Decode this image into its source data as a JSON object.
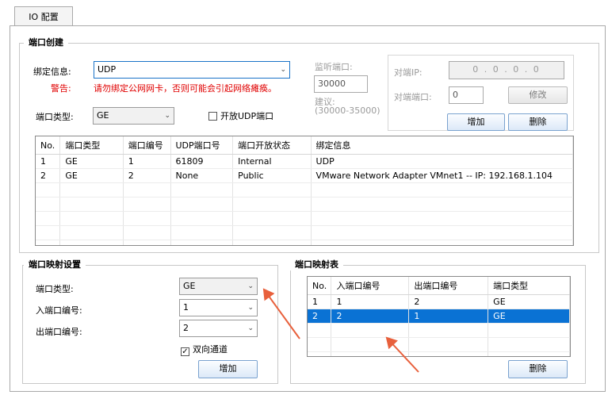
{
  "tab": {
    "label": "IO 配置"
  },
  "creation": {
    "title": "端口创建",
    "bind_label": "绑定信息:",
    "bind_value": "UDP",
    "warn_label": "警告:",
    "warn_text": "请勿绑定公网网卡，否则可能会引起网络瘫痪。",
    "type_label": "端口类型:",
    "type_value": "GE",
    "open_udp_label": "开放UDP端口",
    "listen_label": "监听端口:",
    "listen_value": "30000",
    "suggest_label": "建议:",
    "suggest_range": "(30000-35000)",
    "peer_ip_label": "对端IP:",
    "peer_ip_value": "0 . 0 . 0 . 0",
    "peer_port_label": "对端端口:",
    "peer_port_value": "0",
    "modify_label": "修改",
    "add_label": "增加",
    "delete_label": "删除",
    "table": {
      "headers": [
        "No.",
        "端口类型",
        "端口编号",
        "UDP端口号",
        "端口开放状态",
        "绑定信息"
      ],
      "rows": [
        [
          "1",
          "GE",
          "1",
          "61809",
          "Internal",
          "UDP"
        ],
        [
          "2",
          "GE",
          "2",
          "None",
          "Public",
          "VMware Network Adapter VMnet1 -- IP: 192.168.1.104"
        ]
      ]
    }
  },
  "mapping_settings": {
    "title": "端口映射设置",
    "type_label": "端口类型:",
    "type_value": "GE",
    "in_label": "入端口编号:",
    "in_value": "1",
    "out_label": "出端口编号:",
    "out_value": "2",
    "bidir_label": "双向通道",
    "add_label": "增加"
  },
  "mapping_table": {
    "title": "端口映射表",
    "headers": [
      "No.",
      "入端口编号",
      "出端口编号",
      "端口类型"
    ],
    "rows": [
      [
        "1",
        "1",
        "2",
        "GE"
      ],
      [
        "2",
        "2",
        "1",
        "GE"
      ]
    ],
    "delete_label": "删除"
  },
  "colors": {
    "accent": "#0a72d4",
    "warning": "#e00000",
    "arrow": "#e8603c"
  },
  "icons": {
    "dropdown": "chevron-down-icon",
    "check": "check-icon",
    "arrow": "arrow-annotation"
  }
}
